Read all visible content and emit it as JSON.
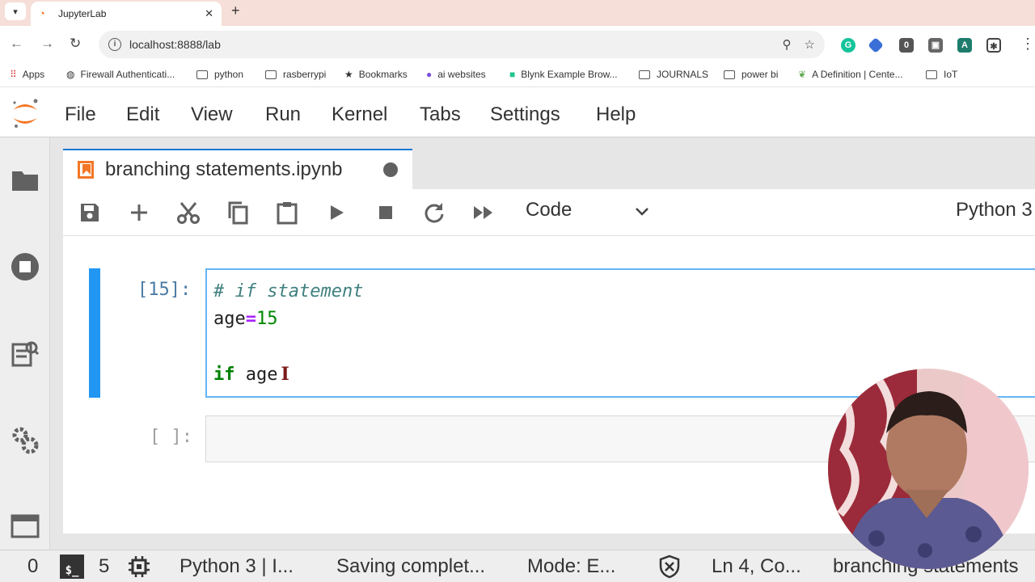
{
  "browser": {
    "tab_title": "JupyterLab",
    "close_glyph": "✕",
    "new_tab_glyph": "+",
    "url": "localhost:8888/lab",
    "ext_badge": "0",
    "bookmarks": [
      "Apps",
      "Firewall Authenticati...",
      "python",
      "rasberrypi",
      "Bookmarks",
      "ai websites",
      "Blynk Example Brow...",
      "JOURNALS",
      "power bi",
      "A Definition | Cente...",
      "IoT"
    ]
  },
  "menubar": {
    "items": [
      "File",
      "Edit",
      "View",
      "Run",
      "Kernel",
      "Tabs",
      "Settings",
      "Help"
    ]
  },
  "document": {
    "tab_title": "branching statements.ipynb"
  },
  "toolbar": {
    "cell_type": "Code",
    "kernel": "Python 3"
  },
  "cells": {
    "active": {
      "prompt": "[15]:",
      "line1_comment": "# if statement",
      "line2_var": "age",
      "line2_op": "=",
      "line2_num": "15",
      "line4_kw": "if",
      "line4_var": "age"
    },
    "empty": {
      "prompt": "[ ]:"
    }
  },
  "statusbar": {
    "count_a": "0",
    "terminal_label": "$_",
    "count_b": "5",
    "kernel_status": "Python 3 | I...",
    "save_status": "Saving complet...",
    "mode": "Mode: E...",
    "cursor_pos": "Ln 4, Co...",
    "file_name": "branching statements"
  },
  "colors": {
    "jupyter_orange": "#f37726",
    "active_blue": "#2196f3",
    "tab_strip": "#f6dfd8"
  }
}
